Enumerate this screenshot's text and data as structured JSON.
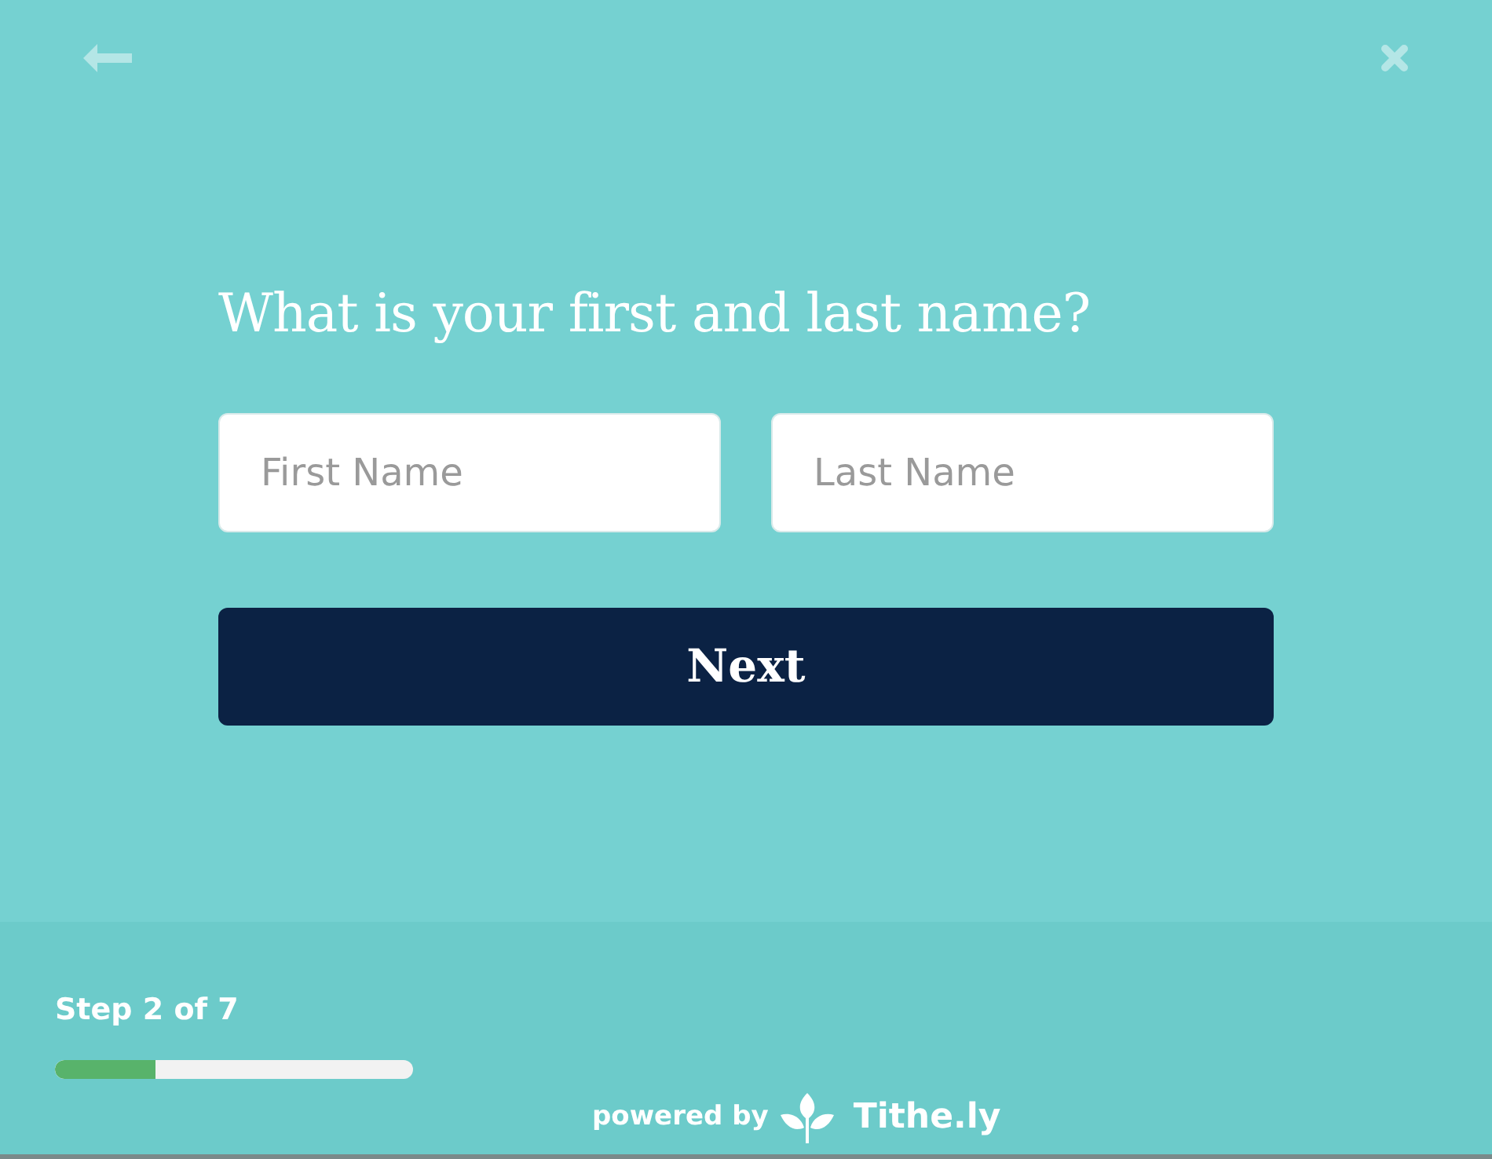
{
  "question": "What is your first and last name?",
  "fields": [
    {
      "placeholder": "First Name"
    },
    {
      "placeholder": "Last Name"
    }
  ],
  "next_button": "Next",
  "progress": {
    "label": "Step 2 of 7",
    "level": 0.28
  },
  "footer": {
    "powered_by": "powered by",
    "brand": "Tithe.ly"
  }
}
